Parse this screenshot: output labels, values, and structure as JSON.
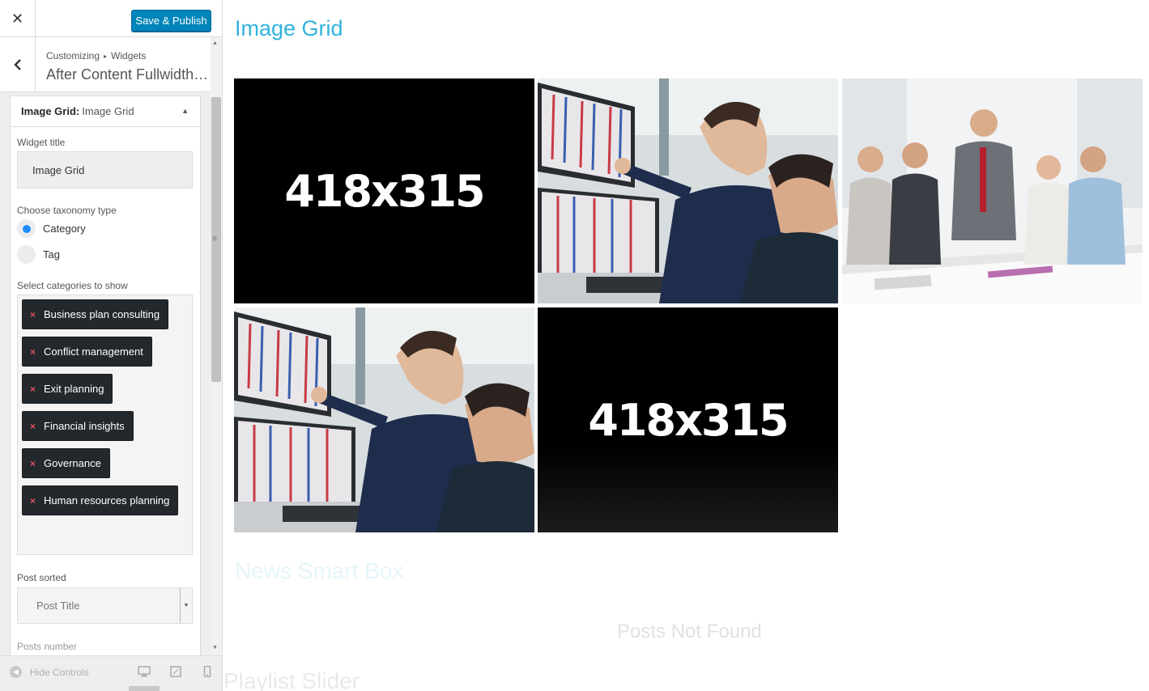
{
  "topbar": {
    "close_icon": "close-icon",
    "publish_label": "Save & Publish",
    "accent": "#0085ba"
  },
  "section": {
    "back_icon": "chevron-left-icon",
    "crumb_root": "Customizing",
    "crumb_separator": "▸",
    "crumb_leaf": "Widgets",
    "title": "After Content Fullwidth…"
  },
  "widget": {
    "name": "Image Grid:",
    "subtitle": "Image Grid",
    "toggle_icon": "arrow-up-icon",
    "title_label": "Widget title",
    "title_value": "Image Grid",
    "taxonomy_label": "Choose taxonomy type",
    "taxonomy_options": [
      {
        "label": "Category",
        "selected": true
      },
      {
        "label": "Tag",
        "selected": false
      }
    ],
    "categories_label": "Select categories to show",
    "categories": [
      "Business plan consulting",
      "Conflict management",
      "Exit planning",
      "Financial insights",
      "Governance",
      "Human resources planning"
    ],
    "chip_remove_glyph": "×",
    "sort_label": "Post sorted",
    "sort_value": "Post Title",
    "number_label": "Posts number"
  },
  "footer": {
    "hide_controls": "Hide Controls",
    "device_icons": [
      "desktop-icon",
      "tablet-icon",
      "mobile-icon"
    ]
  },
  "preview": {
    "grid_title": "Image Grid",
    "title_color": "#31b3dd",
    "tiles": [
      {
        "kind": "placeholder",
        "text": "418x315"
      },
      {
        "kind": "photo",
        "subject": "traders pointing at monitors"
      },
      {
        "kind": "photo",
        "subject": "business team at meeting table"
      },
      {
        "kind": "photo",
        "subject": "traders pointing at monitors"
      },
      {
        "kind": "placeholder",
        "text": "418x315"
      }
    ],
    "news_title": "News Smart Box",
    "not_found": "Posts Not Found",
    "playlist_title": "Playlist Slider"
  }
}
